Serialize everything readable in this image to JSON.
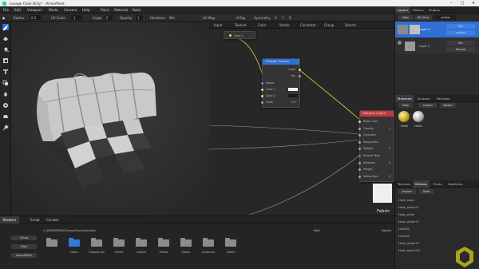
{
  "window": {
    "title": "Lounge Chair Dirty* - ArmorPaint"
  },
  "menu": [
    "File",
    "Edit",
    "Viewport",
    "Mode",
    "Camera",
    "Help",
    "Paint",
    "Material",
    "Bake"
  ],
  "options": {
    "radius_label": "Radius",
    "radius_value": "0.5",
    "uv_scale_label": "UV Scale",
    "uv_scale_value": "1",
    "angle_label": "Angle",
    "angle_value": "0",
    "opacity_label": "Opacity",
    "opacity_value": "1",
    "hardness_label": "Hardness",
    "mix_label": "Mix",
    "uvmap_label": "UV Map",
    "xray_label": "X-Ray",
    "symmetry_label": "Symmetry",
    "sym_x": "X",
    "sym_y": "Y",
    "sym_z": "Z"
  },
  "tools": [
    "brush-icon",
    "eraser-icon",
    "fill-icon",
    "decal-icon",
    "text-icon",
    "clone-icon",
    "blur-icon",
    "particle-icon",
    "bake-icon",
    "picker-icon"
  ],
  "node_tabs": [
    "Input",
    "Texture",
    "Color",
    "Vector",
    "Converter",
    "Group",
    "Search"
  ],
  "nodes": {
    "color_node_label": "Color 2",
    "checker": {
      "title": "Checker Texture",
      "out_color": "Color",
      "out_fac": "Fac",
      "in_vector": "Vector",
      "in_color1": "Color 1",
      "in_color2": "Color 2",
      "in_scale": "Scale",
      "scale_value": "5.0"
    },
    "material": {
      "title": "Material Output",
      "inputs": [
        "Base Color",
        "Opacity",
        "Occlusion",
        "Roughness",
        "Metallic",
        "Normal Map",
        "Emission",
        "Height",
        "Subsurface"
      ],
      "values": [
        "",
        "1",
        "",
        "",
        "0",
        "",
        "0",
        "",
        "0"
      ]
    },
    "preview_label": "Fabric"
  },
  "right": {
    "layer_tabs": [
      "Layers",
      "History",
      "Plugins"
    ],
    "new_label": "New",
    "layer_mode": "2D View",
    "layer_dropdown": "yellow",
    "layers": [
      {
        "name": "Layer 3",
        "blend": "Mix",
        "mask": "yellow",
        "selected": true
      },
      {
        "name": "Layer 2",
        "blend": "Mix",
        "mask": "Shared",
        "selected": false
      }
    ],
    "material_tabs": [
      "Materials",
      "Brushes",
      "Particles"
    ],
    "mat_buttons": [
      "New",
      "Import",
      "Nodes"
    ],
    "materials": [
      "Metal",
      "Fabric"
    ],
    "tex_tabs": [
      "Textures",
      "Meshes",
      "Fonts",
      "Swatches"
    ],
    "tex_buttons": [
      "Import",
      "Tools"
    ],
    "meshes": [
      "Hook_blank",
      "Hook_blank.01",
      "Hook_white",
      "Hook_white.01",
      "Line001",
      "Line002",
      "Hook_white.02",
      "Hook_black.001"
    ]
  },
  "browser": {
    "tabs": [
      "Browser",
      "Script",
      "Console"
    ],
    "path": "C:\\ARMORPAINT\\ArmorPaint\\materials",
    "path_label": "Path",
    "search_label": "Search",
    "side": [
      "Cloud",
      "Disk",
      "ArmorPaint"
    ],
    "folders": [
      "Fabric",
      "Fingerprints",
      "Gravel",
      "Leather",
      "Planks",
      "Plastic",
      "Scratches",
      "Wood"
    ]
  },
  "colors": {
    "accent": "#2f6fd6",
    "yellow": "#e8d84a",
    "purple": "#7d73d8",
    "grey_socket": "#a0a0a0",
    "white": "#f2f2f2",
    "fabric_light": "#d9d9d9",
    "fabric_dark": "#3a3a3a",
    "folder": "#8c8c8c",
    "folder_selected": "#2f7bd6"
  }
}
